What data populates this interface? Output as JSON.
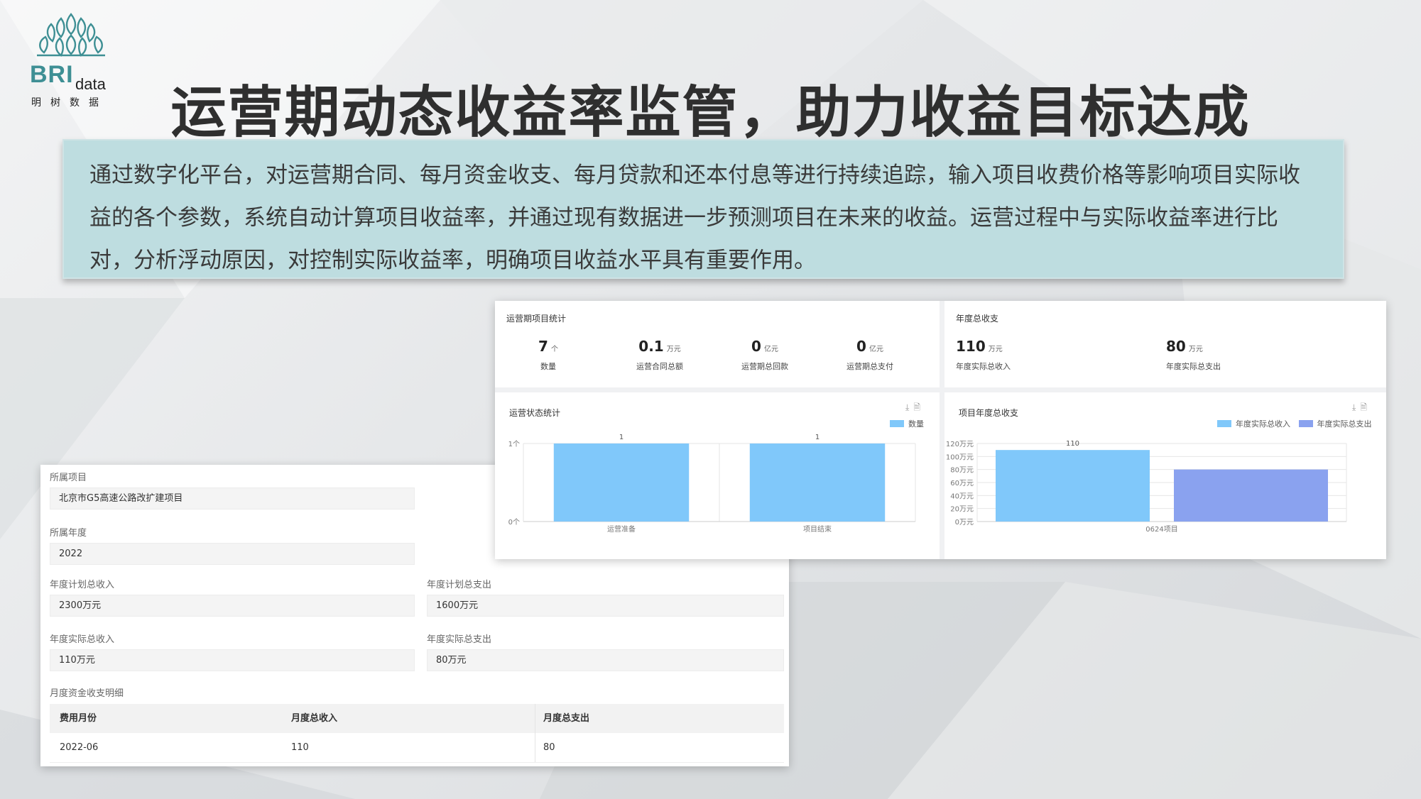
{
  "logo": {
    "brand": "BRI",
    "brand_suffix": "data",
    "cn": "明树数据"
  },
  "title": "运营期动态收益率监管，助力收益目标达成",
  "description": "通过数字化平台，对运营期合同、每月资金收支、每月贷款和还本付息等进行持续追踪，输入项目收费价格等影响项目实际收益的各个参数，系统自动计算项目收益率，并通过现有数据进一步预测项目在未来的收益。运营过程中与实际收益率进行比对，分析浮动原因，对控制实际收益率，明确项目收益水平具有重要作用。",
  "form": {
    "project_label": "所属项目",
    "project_value": "北京市G5高速公路改扩建项目",
    "year_label": "所属年度",
    "year_value": "2022",
    "planned_income_label": "年度计划总收入",
    "planned_income_value": "2300万元",
    "planned_expense_label": "年度计划总支出",
    "planned_expense_value": "1600万元",
    "actual_income_label": "年度实际总收入",
    "actual_income_value": "110万元",
    "actual_expense_label": "年度实际总支出",
    "actual_expense_value": "80万元",
    "monthly_label": "月度资金收支明细",
    "table": {
      "headers": [
        "费用月份",
        "月度总收入",
        "月度总支出"
      ],
      "rows": [
        [
          "2022-06",
          "110",
          "80"
        ]
      ]
    }
  },
  "dashboard": {
    "ops_stats": {
      "title": "运营期项目统计",
      "items": [
        {
          "value": "7",
          "unit": "个",
          "label": "数量"
        },
        {
          "value": "0.1",
          "unit": "万元",
          "label": "运营合同总额"
        },
        {
          "value": "0",
          "unit": "亿元",
          "label": "运营期总回款"
        },
        {
          "value": "0",
          "unit": "亿元",
          "label": "运营期总支付"
        }
      ]
    },
    "annual_stats": {
      "title": "年度总收支",
      "items": [
        {
          "value": "110",
          "unit": "万元",
          "label": "年度实际总收入"
        },
        {
          "value": "80",
          "unit": "万元",
          "label": "年度实际总支出"
        }
      ]
    },
    "icons": {
      "download": "download-icon",
      "data_view": "document-icon"
    }
  },
  "chart_data": [
    {
      "type": "bar",
      "title": "运营状态统计",
      "categories": [
        "运营准备",
        "项目结束"
      ],
      "series": [
        {
          "name": "数量",
          "values": [
            1,
            1
          ],
          "color": "#80c8fa"
        }
      ],
      "data_labels": [
        "1",
        "1"
      ],
      "ylim": [
        0,
        1
      ],
      "yticks": [
        "0个",
        "1个"
      ],
      "legend_position": "top-right",
      "grid": true
    },
    {
      "type": "bar",
      "title": "项目年度总收支",
      "categories": [
        "0624项目"
      ],
      "series": [
        {
          "name": "年度实际总收入",
          "values": [
            110
          ],
          "color": "#80c8fa"
        },
        {
          "name": "年度实际总支出",
          "values": [
            80
          ],
          "color": "#8aa2ef"
        }
      ],
      "data_labels": [
        "110",
        ""
      ],
      "ylim": [
        0,
        120
      ],
      "yticks": [
        "0万元",
        "20万元",
        "40万元",
        "60万元",
        "80万元",
        "100万元",
        "120万元"
      ],
      "legend_position": "top-right",
      "grid": true
    }
  ]
}
